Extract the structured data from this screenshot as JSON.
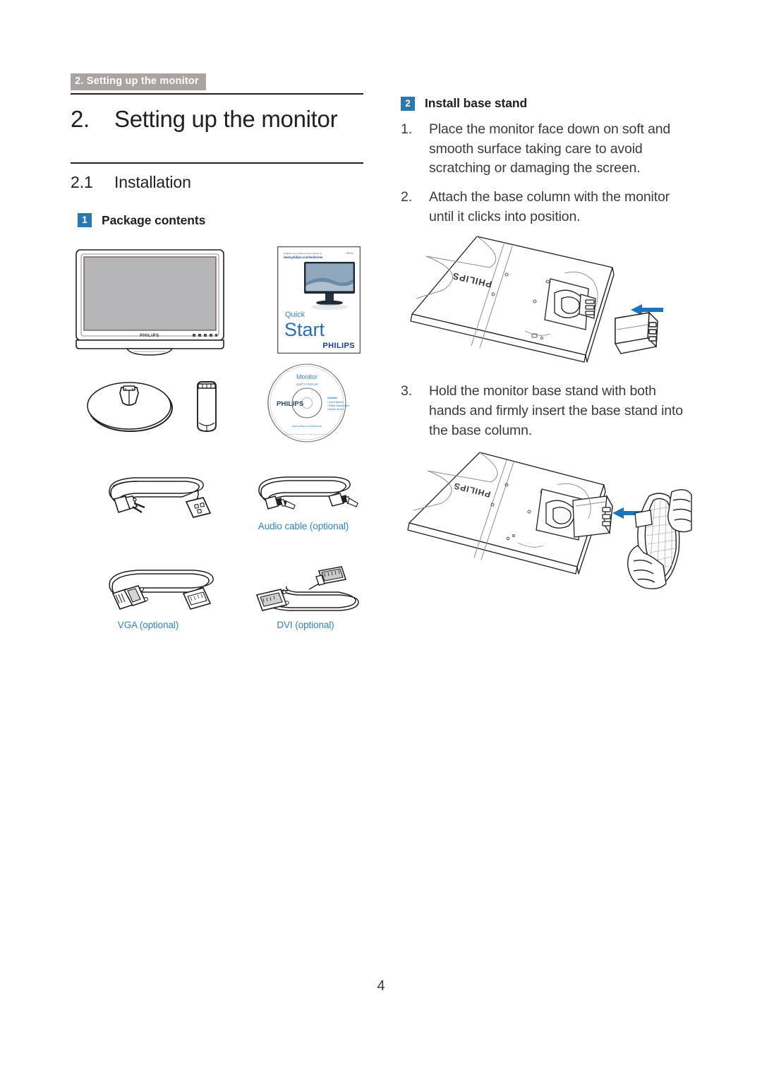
{
  "running_header": "2. Setting up the monitor",
  "chapter": {
    "number": "2.",
    "title": "Setting up the monitor"
  },
  "section": {
    "number": "2.1",
    "title": "Installation"
  },
  "subsections": {
    "package_contents": {
      "badge": "1",
      "title": "Package contents"
    },
    "install_base_stand": {
      "badge": "2",
      "title": "Install base stand"
    }
  },
  "steps": [
    {
      "marker": "1.",
      "text": "Place the monitor face down on soft and smooth surface taking care to avoid scratching or damaging the screen."
    },
    {
      "marker": "2.",
      "text": "Attach the base column with the monitor until it clicks into position."
    },
    {
      "marker": "3.",
      "text": "Hold the monitor base stand with both hands and firmly insert the base stand into the base column."
    }
  ],
  "package_items": {
    "monitor": {
      "brand": "PHILIPS"
    },
    "quick_start": {
      "top_line_1": "Register your product and get support at",
      "top_line_2": "www.philips.com/welcome",
      "model": "196V4L",
      "word_small": "Quick",
      "word_large": "Start",
      "brand": "PHILIPS"
    },
    "base_stand": {
      "label": ""
    },
    "base_column": {
      "label": ""
    },
    "cd": {
      "title": "Monitor",
      "subtitle": "user's manual",
      "brand": "PHILIPS",
      "contents_heading": "Contents",
      "contents": [
        "User's Manual",
        "Philips SmartControl Software",
        "Monitor drivers"
      ],
      "url": "www.philips.com/welcome",
      "fine_print": "All rights reserved. Specifications are subject to change without notice."
    },
    "power_cable": {
      "label": ""
    },
    "audio_cable": {
      "label": "Audio cable (optional)"
    },
    "vga_cable": {
      "label": "VGA (optional)"
    },
    "dvi_cable": {
      "label": "DVI (optional)"
    }
  },
  "diagram_labels": {
    "monitor_back_brand": "PHILIPS",
    "arrow": "left-arrow"
  },
  "colors": {
    "accent_blue": "#2a78b2",
    "caption_blue": "#2f86c8",
    "header_gray": "#a9a3a1",
    "text": "#231f20",
    "body_text": "#3b3b3f"
  },
  "page_number": "4"
}
